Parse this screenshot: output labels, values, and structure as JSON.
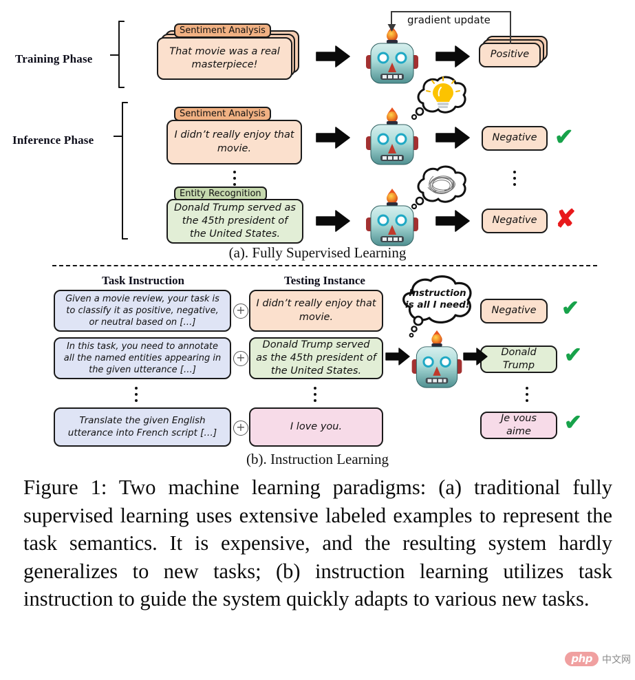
{
  "figure": {
    "caption": "Figure 1: Two machine learning paradigms: (a) traditional fully supervised learning uses extensive labeled examples to represent the task semantics. It is expensive, and the resulting system hardly generalizes to new tasks; (b) instruction learning utilizes task instruction to guide the system quickly adapts to various new tasks.",
    "subcaption_a": "(a). Fully Supervised Learning",
    "subcaption_b": "(b). Instruction Learning"
  },
  "panel_a": {
    "phases": {
      "training": "Training Phase",
      "inference": "Inference Phase"
    },
    "gradient_update_label": "gradient update",
    "training_example": {
      "tag": "Sentiment Analysis",
      "text": "That movie was a real masterpiece!",
      "output": "Positive"
    },
    "inference_examples": [
      {
        "tag": "Sentiment Analysis",
        "text": "I didn’t really enjoy that movie.",
        "output": "Negative",
        "verdict": "correct",
        "verdict_glyph": "✔",
        "thought": "lightbulb"
      },
      {
        "tag": "Entity Recognition",
        "text": "Donald Trump served as the 45th president of the United States.",
        "output": "Negative",
        "verdict": "wrong",
        "verdict_glyph": "✘",
        "thought": "scribble"
      }
    ]
  },
  "panel_b": {
    "columns": {
      "instruction": "Task Instruction",
      "instance": "Testing Instance"
    },
    "robot_thought": "Instruction is all I need!",
    "combine_symbol": "+",
    "rows": [
      {
        "instruction": "Given a movie review, your task is to classify it as positive, negative, or neutral based on […]",
        "instance": "I didn’t really enjoy that movie.",
        "output": "Negative",
        "verdict_glyph": "✔"
      },
      {
        "instruction": "In this task, you need to annotate all the named entities appearing in the given utterance […]",
        "instance": "Donald Trump served as the 45th president of the United States.",
        "output": "Donald Trump",
        "verdict_glyph": "✔"
      },
      {
        "instruction": "Translate the given English utterance into French script […]",
        "instance": "I love you.",
        "output": "Je vous aime",
        "verdict_glyph": "✔"
      }
    ]
  },
  "watermark": {
    "php": "php",
    "cn": "中文网"
  },
  "colors": {
    "peach": "#fbe0cd",
    "tag_orange": "#f0b183",
    "green": "#e2eed6",
    "tag_green": "#c6d9ae",
    "blue": "#dfe4f5",
    "pink": "#f7dbe8",
    "tick_green": "#17a24a",
    "cross_red": "#e8191b",
    "robot_body": "#7fc9c4"
  }
}
